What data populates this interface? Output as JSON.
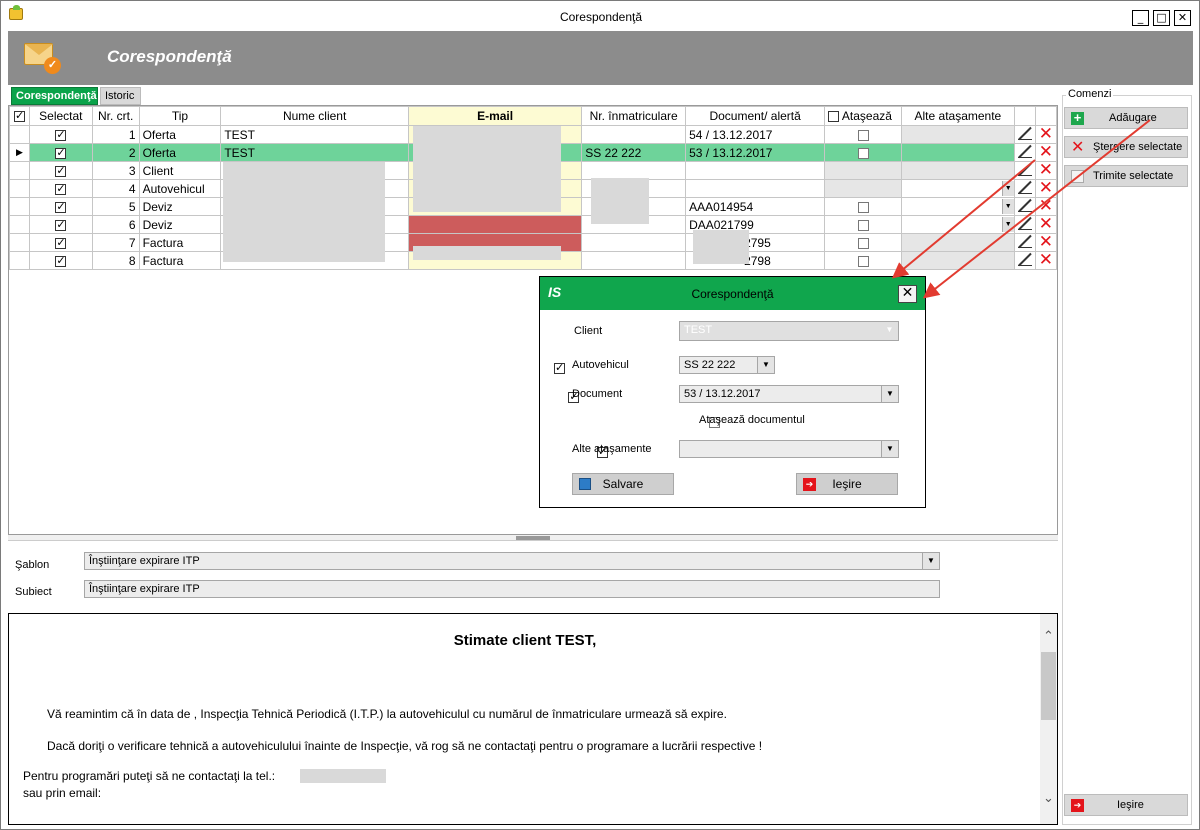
{
  "window": {
    "title": "Corespondenţă",
    "minimize": "_",
    "maximize": "□",
    "close": "✕"
  },
  "header": {
    "title": "Corespondenţă"
  },
  "tabs": [
    {
      "label": "Corespondenţă"
    },
    {
      "label": "Istoric"
    }
  ],
  "grid": {
    "headers": [
      "Selectat",
      "Nr. crt.",
      "Tip",
      "Nume client",
      "E-mail",
      "Nr. înmatriculare",
      "Document/ alertă",
      "Ataşează",
      "Alte ataşamente"
    ],
    "rows": [
      {
        "nr": "1",
        "tip": "Oferta",
        "client": "TEST",
        "nr_inm": "",
        "document": "54 / 13.12.2017",
        "selected": true,
        "atas": true
      },
      {
        "nr": "2",
        "tip": "Oferta",
        "client": "TEST",
        "nr_inm": "SS 22 222",
        "document": "53 / 13.12.2017",
        "selected": true,
        "atas": true
      },
      {
        "nr": "3",
        "tip": "Client",
        "client": "",
        "nr_inm": "",
        "document": "",
        "selected": true,
        "atas": false
      },
      {
        "nr": "4",
        "tip": "Autovehicul",
        "client": "",
        "nr_inm": "",
        "document": "",
        "selected": true,
        "atas": false
      },
      {
        "nr": "5",
        "tip": "Deviz",
        "client": "",
        "nr_inm": "",
        "document": "AAA014954",
        "selected": true,
        "atas": true
      },
      {
        "nr": "6",
        "tip": "Deviz",
        "client": "",
        "nr_inm": "",
        "document": "DAA021799",
        "selected": true,
        "atas": true
      },
      {
        "nr": "7",
        "tip": "Factura",
        "client": "",
        "nr_inm": "",
        "document": "2795",
        "selected": true,
        "atas": true
      },
      {
        "nr": "8",
        "tip": "Factura",
        "client": "",
        "nr_inm": "",
        "document": "2798",
        "selected": true,
        "atas": true
      }
    ]
  },
  "form": {
    "sablon_label": "Şablon",
    "sablon_value": "Înştiinţare expirare ITP",
    "subiect_label": "Subiect",
    "subiect_value": "Înştiinţare expirare ITP"
  },
  "email": {
    "greeting": "Stimate client TEST,",
    "p1": "Vă reamintim că în data de , Inspecţia Tehnică Periodică (I.T.P.) la autovehiculul cu numărul de înmatriculare urmează să expire.",
    "p2": "Dacă doriţi o verificare tehnică a autovehiculului înainte de Inspecţie, vă rog să ne contactaţi pentru o programare a lucrării respective !",
    "p3": "Pentru programări puteţi să ne contactaţi la tel.:",
    "p4": "sau prin email:"
  },
  "commands": {
    "group_label": "Comenzi",
    "add": "Adăugare",
    "delete_selected": "Ştergere selectate",
    "send_selected": "Trimite selectate",
    "exit": "Ieşire"
  },
  "dialog": {
    "title": "Corespondenţă",
    "logo": "IS",
    "client_label": "Client",
    "client_value": "TEST",
    "auto_label": "Autovehicul",
    "auto_value": "SS 22 222",
    "doc_label": "Document",
    "doc_value": "53 / 13.12.2017",
    "attach_doc_label": "Ataşează documentul",
    "other_label": "Alte ataşamente",
    "save": "Salvare",
    "exit": "Ieşire"
  },
  "colors": {
    "accent_green": "#10a64d",
    "selected_row": "#6ed39a",
    "header_gray": "#8c8c8c",
    "email_header": "#fdfbd3"
  }
}
